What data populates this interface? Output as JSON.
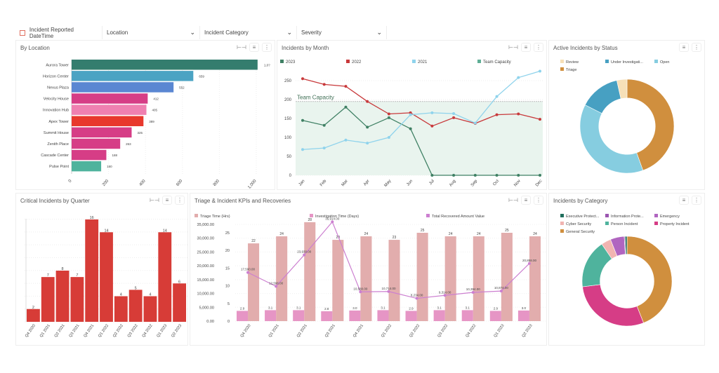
{
  "filters": [
    {
      "label": "Incident Reported DateTime",
      "type": "checkbox"
    },
    {
      "label": "Location",
      "type": "dropdown"
    },
    {
      "label": "Incident Category",
      "type": "dropdown"
    },
    {
      "label": "Severity",
      "type": "dropdown"
    }
  ],
  "panels": {
    "location": {
      "title": "By Location"
    },
    "month": {
      "title": "Incidents by Month"
    },
    "status": {
      "title": "Active Incidents by Status"
    },
    "critical": {
      "title": "Critical Incidents by Quarter"
    },
    "kpi": {
      "title": "Triage & Incident KPIs and Recoveries"
    },
    "category": {
      "title": "Incidents by Category"
    }
  },
  "chart_data": [
    {
      "id": "location",
      "type": "bar",
      "orientation": "horizontal",
      "categories": [
        "Aurora Tower",
        "Horizon Center",
        "Nexus Plaza",
        "Velocity House",
        "Innovation Hub",
        "Apex Tower",
        "Summit House",
        "Zenith Place",
        "Cascade Center",
        "Pulse Point"
      ],
      "values": [
        1007,
        659,
        552,
        412,
        405,
        389,
        325,
        263,
        188,
        160
      ],
      "labels": [
        "1,0?",
        "659",
        "552",
        "412",
        "405",
        "389",
        "325",
        "263",
        "188",
        "160"
      ],
      "colors": [
        "#347d6e",
        "#4ba3c3",
        "#5a87d2",
        "#d63d86",
        "#ef80b1",
        "#e8382d",
        "#d63d86",
        "#d63d86",
        "#d63d86",
        "#4fb39d"
      ],
      "xlim": [
        0,
        1000
      ],
      "xticks": [
        "0",
        "200",
        "400",
        "600",
        "800",
        "1,000"
      ],
      "grid": true
    },
    {
      "id": "month",
      "type": "line",
      "categories": [
        "Jan",
        "Feb",
        "Mar",
        "Apr",
        "May",
        "Jun",
        "Jul",
        "Aug",
        "Sep",
        "Oct",
        "Nov",
        "Dec"
      ],
      "ylim": [
        0,
        280
      ],
      "yticks": [
        0,
        50,
        100,
        150,
        200,
        250
      ],
      "grid": true,
      "legend": "top",
      "series": [
        {
          "name": "2023",
          "color": "#3f8064",
          "values": [
            145,
            132,
            180,
            127,
            152,
            123,
            0,
            0,
            0,
            0,
            0,
            0
          ]
        },
        {
          "name": "2022",
          "color": "#c8393b",
          "values": [
            255,
            240,
            235,
            195,
            162,
            165,
            130,
            152,
            137,
            160,
            162,
            148
          ]
        },
        {
          "name": "2021",
          "color": "#8fd3ec",
          "values": [
            68,
            72,
            93,
            85,
            100,
            160,
            165,
            163,
            138,
            208,
            258,
            275
          ]
        }
      ],
      "band": {
        "name": "Team Capacity",
        "label": "Team Capacity",
        "value": 195,
        "color": "#5eae95"
      }
    },
    {
      "id": "status",
      "type": "pie",
      "donut": true,
      "legend": "top",
      "slices": [
        {
          "name": "Triage",
          "value": 44.5,
          "color": "#d08f3e"
        },
        {
          "name": "Open",
          "value": 38,
          "color": "#86cde0"
        },
        {
          "name": "Under Investigati...",
          "value": 14,
          "color": "#47a0c2"
        },
        {
          "name": "Review",
          "value": 3.5,
          "color": "#f6e0b8"
        }
      ],
      "legend_order": [
        "Review",
        "Under Investigati...",
        "Open",
        "Triage"
      ]
    },
    {
      "id": "critical",
      "type": "bar",
      "categories": [
        "Q4 2020",
        "Q1 2021",
        "Q2 2021",
        "Q3 2021",
        "Q4 2021",
        "Q1 2022",
        "Q2 2022",
        "Q3 2022",
        "Q4 2022",
        "Q1 2023",
        "Q2 2023"
      ],
      "values": [
        2,
        7,
        8,
        7,
        16,
        14,
        4,
        5,
        4,
        14,
        6
      ],
      "color": "#d73c37",
      "ylim": [
        0,
        16
      ],
      "grid": true
    },
    {
      "id": "kpi",
      "type": "bar",
      "categories": [
        "Q4 2020",
        "Q1 2021",
        "Q2 2021",
        "Q3 2021",
        "Q4 2021",
        "Q1 2022",
        "Q2 2022",
        "Q3 2022",
        "Q4 2022",
        "Q1 2023",
        "Q2 2023"
      ],
      "legend": "top",
      "y_left": {
        "ylim": [
          0,
          35000
        ],
        "ticks": [
          "0.00",
          "5,000.00",
          "10,000.00",
          "15,000.00",
          "20,000.00",
          "25,000.00",
          "30,000.00",
          "35,000.00"
        ]
      },
      "y_right": {
        "ylim": [
          0,
          25
        ],
        "ticks": [
          "0",
          "5",
          "10",
          "15",
          "20",
          "25"
        ]
      },
      "series": [
        {
          "name": "Triage Time (Hrs)",
          "type": "bar",
          "color": "#e2adad",
          "values": [
            22,
            24,
            28,
            23,
            24,
            23,
            25,
            24,
            24,
            25,
            24
          ],
          "labels": [
            "22",
            "24",
            "28",
            "23",
            "24",
            "23",
            "25",
            "24",
            "24",
            "25",
            "24"
          ]
        },
        {
          "name": "Investigation Time (Days)",
          "type": "bar",
          "color": "#e695c5",
          "values": [
            2.9,
            3.1,
            3.1,
            2.8,
            3.0,
            3.1,
            2.9,
            3.1,
            3.1,
            2.9,
            3.0
          ],
          "labels": [
            "2.9",
            "3.1",
            "3.1",
            "2.8",
            "3.0",
            "3.1",
            "2.9",
            "3.1",
            "3.1",
            "2.9",
            "3.0"
          ]
        },
        {
          "name": "Total Recovered Amount Value",
          "type": "line",
          "color": "#cc7fd0",
          "values": [
            17590,
            12596,
            23930,
            35914,
            10580,
            10714,
            8234,
            9314,
            10394,
            10874,
            20858
          ],
          "labels": [
            "17,590.00",
            "12,596.00",
            "23,930.00",
            "35,914.00",
            "10,580.00",
            "10,714.00",
            "8,234.00",
            "9,314.00",
            "10,394.00",
            "10,874.00",
            "20,858.00"
          ]
        }
      ]
    },
    {
      "id": "category",
      "type": "pie",
      "donut": true,
      "legend": "top",
      "slices": [
        {
          "name": "General Security",
          "value": 44,
          "color": "#d08f3e"
        },
        {
          "name": "Property Incident",
          "value": 29,
          "color": "#d63d86"
        },
        {
          "name": "Person Incident",
          "value": 17.5,
          "color": "#4fb39d"
        },
        {
          "name": "Cyber Security",
          "value": 3.5,
          "color": "#f1b4b1"
        },
        {
          "name": "Emergency",
          "value": 5,
          "color": "#b065c0"
        },
        {
          "name": "Information Prote...",
          "value": 0.3,
          "color": "#9a55b0"
        },
        {
          "name": "Executive Protect...",
          "value": 0.7,
          "color": "#1f6e5c"
        }
      ],
      "legend_order": [
        "Executive Protect...",
        "Information Prote...",
        "Emergency",
        "Cyber Security",
        "Person Incident",
        "Property Incident",
        "General Security"
      ]
    }
  ]
}
